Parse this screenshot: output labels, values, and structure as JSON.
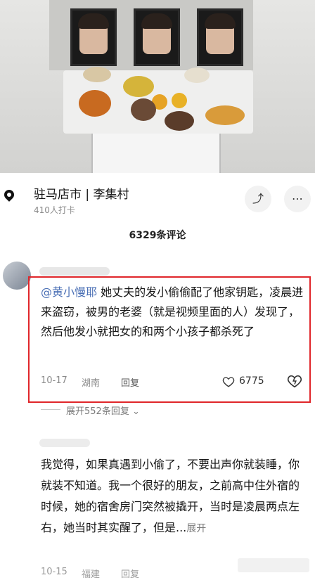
{
  "location": {
    "title": "驻马店市 | 李集村",
    "checkins": "410人打卡",
    "share_icon": "share-icon",
    "more_icon": "more-icon"
  },
  "comments": {
    "count": "6329条评论",
    "first": {
      "mention": "@黄小慢耶",
      "text": " 她丈夫的发小偷偷配了他家钥匙，凌晨进来盗窃，被男的老婆（就是视频里面的人）发现了，然后他发小就把女的和两个小孩子都杀死了",
      "date": "10-17",
      "region": "湖南",
      "reply": "回复",
      "likes": "6775"
    },
    "expand": "展开552条回复",
    "second": {
      "text": "我觉得，如果真遇到小偷了，不要出声你就装睡，你就装不知道。我一个很好的朋友，之前高中住外宿的时候，她的宿舍房门突然被撬开，当时是凌晨两点左右，她当时其实醒了，但是...",
      "more": "展开",
      "date": "10-15",
      "region": "福建",
      "reply": "回复"
    }
  },
  "accent": {
    "highlight": "#e0262a",
    "mention": "#4a6fb5"
  }
}
